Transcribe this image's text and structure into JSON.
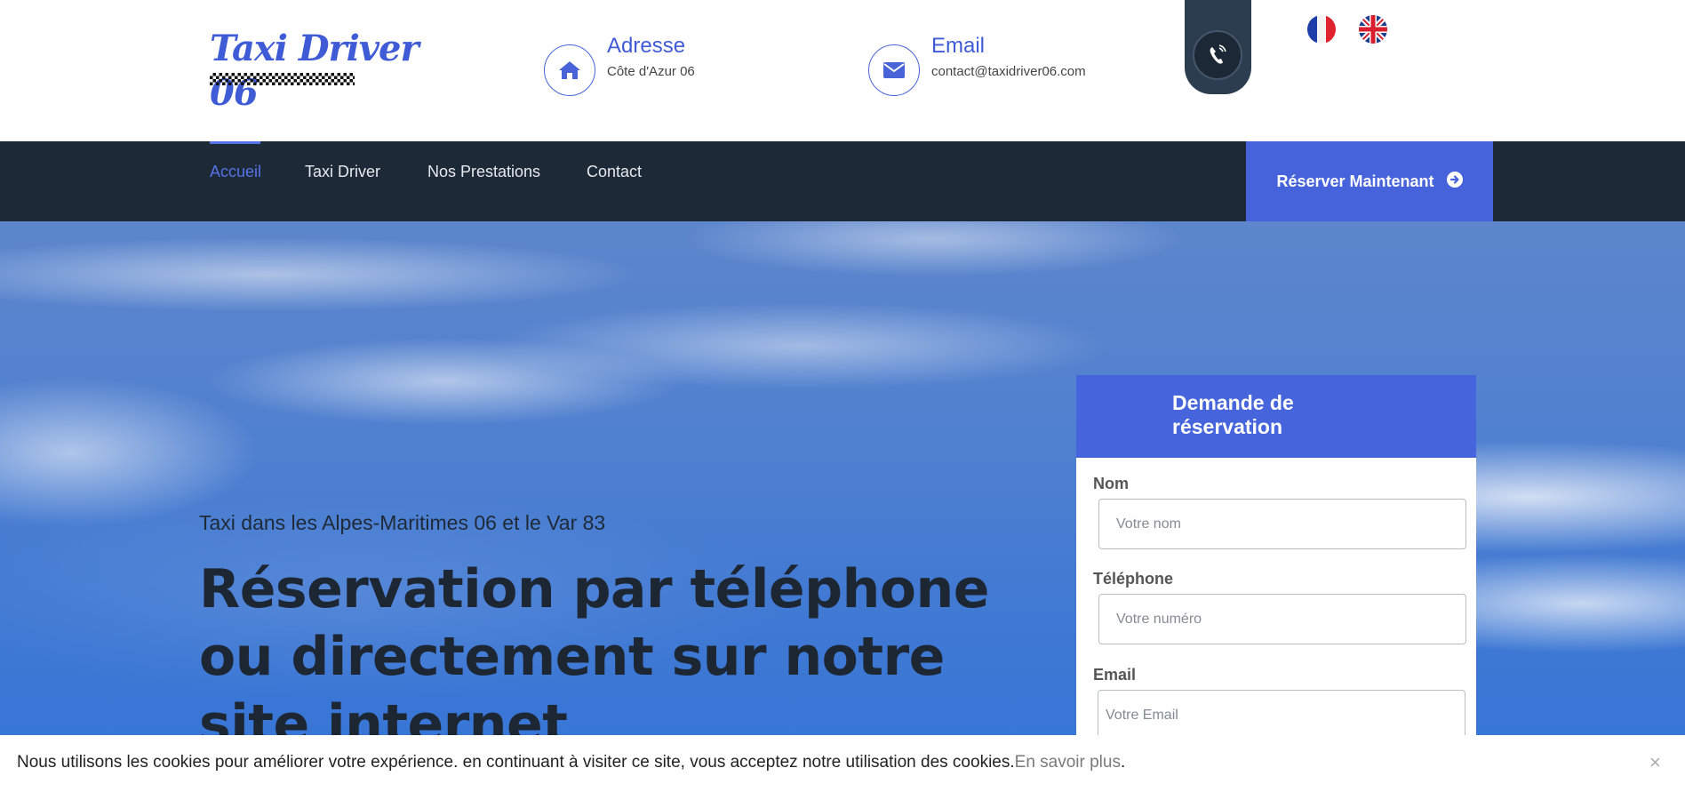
{
  "header": {
    "logo_text": "Taxi Driver 06",
    "address": {
      "title": "Adresse",
      "value": "Côte d'Azur 06",
      "icon": "home-icon"
    },
    "email": {
      "title": "Email",
      "value": "contact@taxidriver06.com",
      "icon": "envelope-icon"
    },
    "phone_icon": "phone-icon",
    "languages": [
      "fr",
      "en"
    ]
  },
  "nav": {
    "items": [
      {
        "label": "Accueil",
        "active": true
      },
      {
        "label": "Taxi Driver",
        "active": false
      },
      {
        "label": "Nos Prestations",
        "active": false
      },
      {
        "label": "Contact",
        "active": false
      }
    ],
    "reserve_button": "Réserver Maintenant"
  },
  "hero": {
    "subtitle": "Taxi dans les Alpes-Maritimes 06 et le Var 83",
    "title": "Réservation par téléphone ou directement sur notre site internet"
  },
  "form": {
    "title": "Demande de réservation",
    "fields": [
      {
        "label": "Nom",
        "placeholder": "Votre nom"
      },
      {
        "label": "Téléphone",
        "placeholder": "Votre numéro"
      },
      {
        "label": "Email",
        "placeholder": "Votre Email"
      }
    ]
  },
  "cookie": {
    "text": "Nous utilisons les cookies pour améliorer votre expérience. en continuant à visiter ce site, vous acceptez notre utilisation des cookies.",
    "link": "En savoir plus",
    "suffix": ".",
    "close": "×"
  },
  "colors": {
    "accent": "#4664dc",
    "nav_bg": "#1e2937",
    "title_dark": "#1d2633"
  }
}
